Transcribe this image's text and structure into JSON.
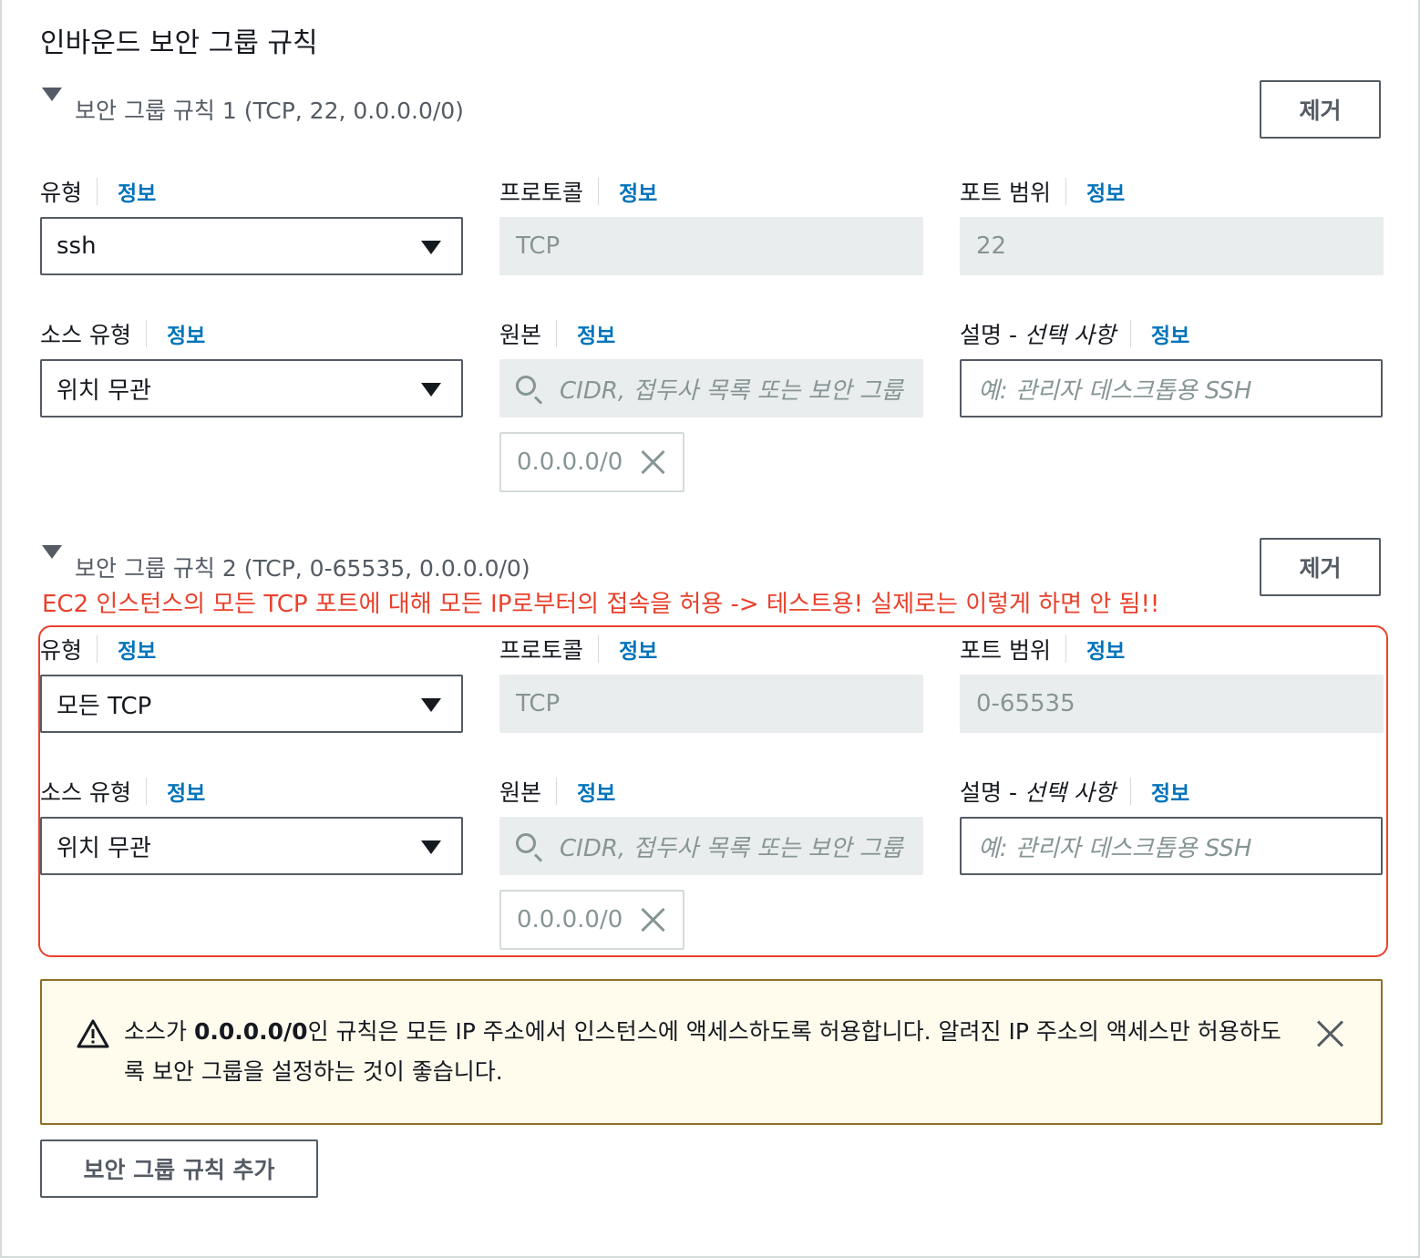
{
  "section_title": "인바운드 보안 그룹 규칙",
  "info_label": "정보",
  "rules": [
    {
      "header": "보안 그룹 규칙 1 (TCP, 22, 0.0.0.0/0)",
      "remove_label": "제거",
      "type_label": "유형",
      "type_value": "ssh",
      "protocol_label": "프로토콜",
      "protocol_value": "TCP",
      "port_label": "포트 범위",
      "port_value": "22",
      "source_type_label": "소스 유형",
      "source_type_value": "위치 무관",
      "source_label": "원본",
      "source_placeholder": "CIDR, 접두사 목록 또는 보안 그룹",
      "source_token": "0.0.0.0/0",
      "description_label": "설명 - ",
      "description_optional": "선택 사항",
      "description_placeholder": "예: 관리자 데스크톱용 SSH"
    },
    {
      "header": "보안 그룹 규칙 2 (TCP, 0-65535, 0.0.0.0/0)",
      "remove_label": "제거",
      "type_label": "유형",
      "type_value": "모든 TCP",
      "protocol_label": "프로토콜",
      "protocol_value": "TCP",
      "port_label": "포트 범위",
      "port_value": "0-65535",
      "source_type_label": "소스 유형",
      "source_type_value": "위치 무관",
      "source_label": "원본",
      "source_placeholder": "CIDR, 접두사 목록 또는 보안 그룹",
      "source_token": "0.0.0.0/0",
      "description_label": "설명 - ",
      "description_optional": "선택 사항",
      "description_placeholder": "예: 관리자 데스크톱용 SSH"
    }
  ],
  "annotation": "EC2 인스턴스의 모든 TCP 포트에 대해 모든 IP로부터의 접속을 허용 -> 테스트용! 실제로는 이렇게 하면 안 됨!!",
  "alert": {
    "pre": "소스가 ",
    "bold": "0.0.0.0/0",
    "post": "인 규칙은 모든 IP 주소에서 인스턴스에 액세스하도록 허용합니다. 알려진 IP 주소의 액세스만 허용하도록 보안 그룹을 설정하는 것이 좋습니다."
  },
  "add_rule_label": "보안 그룹 규칙 추가",
  "colors": {
    "info_link": "#0073bb",
    "annotation": "#e8412c",
    "alert_bg": "#fffcee",
    "alert_border": "#917025"
  }
}
